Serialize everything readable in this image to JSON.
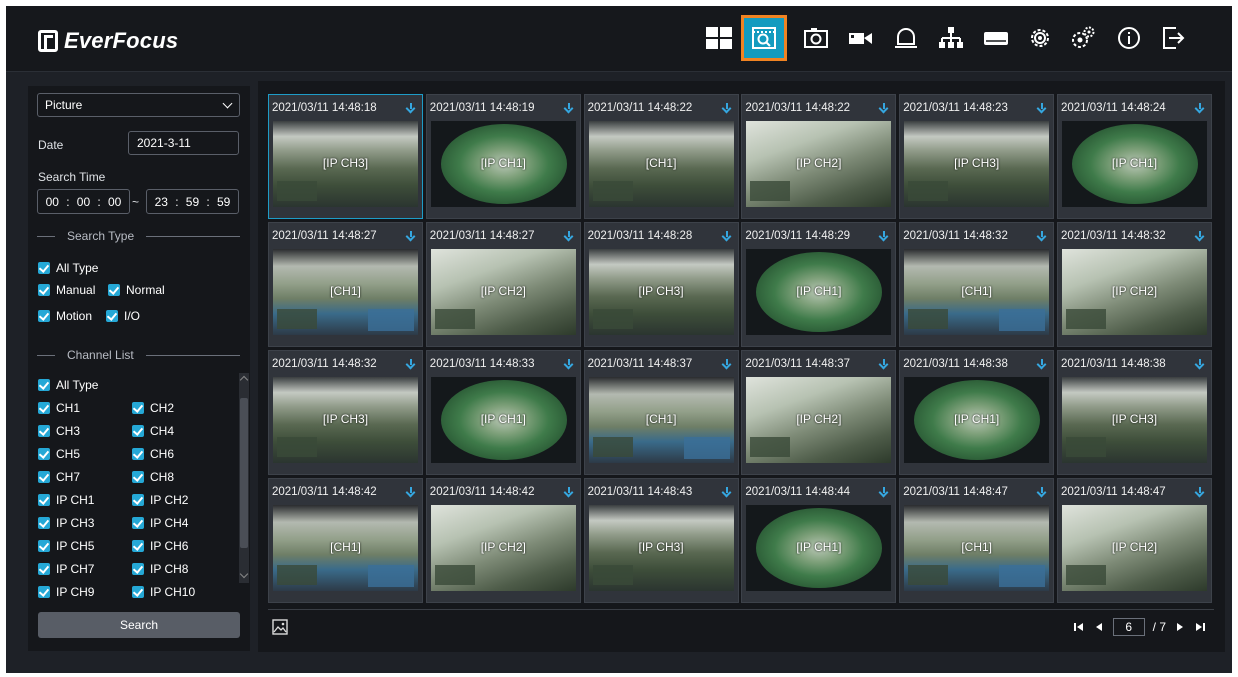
{
  "brand": {
    "name": "EverFocus"
  },
  "nav": {
    "items": [
      {
        "name": "live-view",
        "icon": "grid-icon"
      },
      {
        "name": "search",
        "icon": "search-playback-icon",
        "active": true
      },
      {
        "name": "snapshot",
        "icon": "camera-icon"
      },
      {
        "name": "record",
        "icon": "video-camera-icon"
      },
      {
        "name": "alarm",
        "icon": "bell-icon"
      },
      {
        "name": "network",
        "icon": "network-icon"
      },
      {
        "name": "storage",
        "icon": "hdd-icon"
      },
      {
        "name": "settings",
        "icon": "gear-icon"
      },
      {
        "name": "advanced-settings",
        "icon": "gears-icon"
      },
      {
        "name": "info",
        "icon": "info-icon"
      },
      {
        "name": "logout",
        "icon": "logout-icon"
      }
    ]
  },
  "sidebar": {
    "mode_select": "Picture",
    "date_label": "Date",
    "date_value": "2021-3-11",
    "search_time_label": "Search Time",
    "start_time": {
      "h": "00",
      "m": "00",
      "s": "00"
    },
    "end_time": {
      "h": "23",
      "m": "59",
      "s": "59"
    },
    "time_sep": ":",
    "range_sep": "~",
    "search_type_title": "Search Type",
    "search_types": [
      "All Type",
      "Manual",
      "Normal",
      "Motion",
      "I/O"
    ],
    "channel_list_title": "Channel List",
    "channels_all": "All Type",
    "channels": [
      "CH1",
      "CH2",
      "CH3",
      "CH4",
      "CH5",
      "CH6",
      "CH7",
      "CH8",
      "IP CH1",
      "IP CH2",
      "IP CH3",
      "IP CH4",
      "IP CH5",
      "IP CH6",
      "IP CH7",
      "IP CH8",
      "IP CH9",
      "IP CH10"
    ],
    "search_button": "Search"
  },
  "results": [
    {
      "time": "2021/03/11 14:48:18",
      "label": "[IP CH3]",
      "kind": "office"
    },
    {
      "time": "2021/03/11 14:48:19",
      "label": "[IP CH1]",
      "kind": "fish"
    },
    {
      "time": "2021/03/11 14:48:22",
      "label": "[CH1]",
      "kind": "office"
    },
    {
      "time": "2021/03/11 14:48:22",
      "label": "[IP CH2]",
      "kind": "office2"
    },
    {
      "time": "2021/03/11 14:48:23",
      "label": "[IP CH3]",
      "kind": "office"
    },
    {
      "time": "2021/03/11 14:48:24",
      "label": "[IP CH1]",
      "kind": "fish"
    },
    {
      "time": "2021/03/11 14:48:27",
      "label": "[CH1]",
      "kind": "office3"
    },
    {
      "time": "2021/03/11 14:48:27",
      "label": "[IP CH2]",
      "kind": "office2"
    },
    {
      "time": "2021/03/11 14:48:28",
      "label": "[IP CH3]",
      "kind": "office"
    },
    {
      "time": "2021/03/11 14:48:29",
      "label": "[IP CH1]",
      "kind": "fish"
    },
    {
      "time": "2021/03/11 14:48:32",
      "label": "[CH1]",
      "kind": "office3"
    },
    {
      "time": "2021/03/11 14:48:32",
      "label": "[IP CH2]",
      "kind": "office2"
    },
    {
      "time": "2021/03/11 14:48:32",
      "label": "[IP CH3]",
      "kind": "office"
    },
    {
      "time": "2021/03/11 14:48:33",
      "label": "[IP CH1]",
      "kind": "fish"
    },
    {
      "time": "2021/03/11 14:48:37",
      "label": "[CH1]",
      "kind": "office3"
    },
    {
      "time": "2021/03/11 14:48:37",
      "label": "[IP CH2]",
      "kind": "office2"
    },
    {
      "time": "2021/03/11 14:48:38",
      "label": "[IP CH1]",
      "kind": "fish"
    },
    {
      "time": "2021/03/11 14:48:38",
      "label": "[IP CH3]",
      "kind": "office"
    },
    {
      "time": "2021/03/11 14:48:42",
      "label": "[CH1]",
      "kind": "office3"
    },
    {
      "time": "2021/03/11 14:48:42",
      "label": "[IP CH2]",
      "kind": "office2"
    },
    {
      "time": "2021/03/11 14:48:43",
      "label": "[IP CH3]",
      "kind": "office"
    },
    {
      "time": "2021/03/11 14:48:44",
      "label": "[IP CH1]",
      "kind": "fish"
    },
    {
      "time": "2021/03/11 14:48:47",
      "label": "[CH1]",
      "kind": "office3"
    },
    {
      "time": "2021/03/11 14:48:47",
      "label": "[IP CH2]",
      "kind": "office2"
    }
  ],
  "pager": {
    "current": "6",
    "total": "/ 7"
  },
  "colors": {
    "accent": "#139bbf",
    "highlight": "#f08322",
    "check": "#25a8d6"
  }
}
